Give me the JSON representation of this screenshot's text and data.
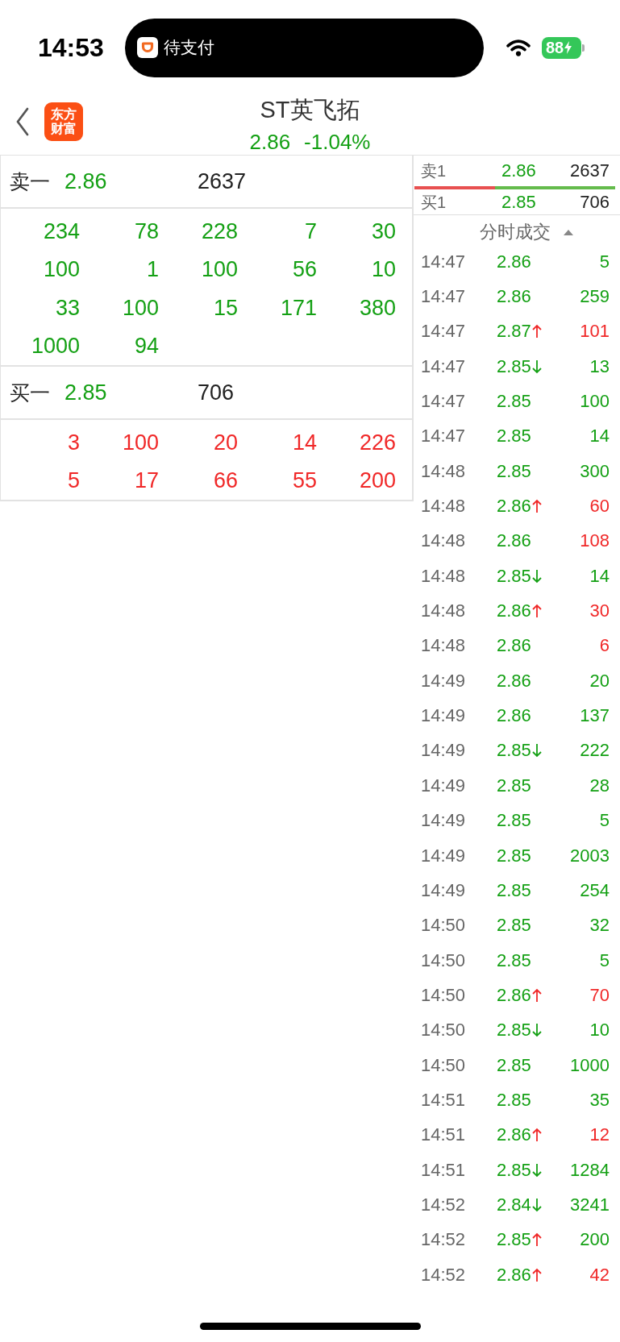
{
  "status_bar": {
    "time": "14:53",
    "activity": "待支付",
    "battery": "88"
  },
  "header": {
    "logo": "东方财富",
    "title": "ST英飞拓",
    "price": "2.86",
    "change": "-1.04%",
    "falling": true
  },
  "order_book": {
    "sides": [
      {
        "label": "卖一",
        "price": "2.86",
        "volume": "2637",
        "bid": false,
        "queue": [
          "234",
          "78",
          "228",
          "7",
          "30",
          "100",
          "1",
          "100",
          "56",
          "10",
          "33",
          "100",
          "15",
          "171",
          "380",
          "1000",
          "94"
        ]
      },
      {
        "label": "买一",
        "price": "2.85",
        "volume": "706",
        "bid": true,
        "queue": [
          "3",
          "100",
          "20",
          "14",
          "226",
          "5",
          "17",
          "66",
          "55",
          "200"
        ]
      }
    ]
  },
  "level1": {
    "rows": [
      {
        "label": "卖1",
        "price": "2.86",
        "volume": "2637"
      },
      {
        "label": "买1",
        "price": "2.85",
        "volume": "706"
      }
    ],
    "ratio": {
      "level": 0.4
    }
  },
  "trades": {
    "title": "分时成交",
    "rows": [
      {
        "time": "14:47",
        "price": "2.86",
        "up": false,
        "down": false,
        "volume": "5",
        "buy": false
      },
      {
        "time": "14:47",
        "price": "2.86",
        "up": false,
        "down": false,
        "volume": "259",
        "buy": false
      },
      {
        "time": "14:47",
        "price": "2.87",
        "up": true,
        "down": false,
        "volume": "101",
        "buy": true
      },
      {
        "time": "14:47",
        "price": "2.85",
        "up": false,
        "down": true,
        "volume": "13",
        "buy": false
      },
      {
        "time": "14:47",
        "price": "2.85",
        "up": false,
        "down": false,
        "volume": "100",
        "buy": false
      },
      {
        "time": "14:47",
        "price": "2.85",
        "up": false,
        "down": false,
        "volume": "14",
        "buy": false
      },
      {
        "time": "14:48",
        "price": "2.85",
        "up": false,
        "down": false,
        "volume": "300",
        "buy": false
      },
      {
        "time": "14:48",
        "price": "2.86",
        "up": true,
        "down": false,
        "volume": "60",
        "buy": true
      },
      {
        "time": "14:48",
        "price": "2.86",
        "up": false,
        "down": false,
        "volume": "108",
        "buy": true
      },
      {
        "time": "14:48",
        "price": "2.85",
        "up": false,
        "down": true,
        "volume": "14",
        "buy": false
      },
      {
        "time": "14:48",
        "price": "2.86",
        "up": true,
        "down": false,
        "volume": "30",
        "buy": true
      },
      {
        "time": "14:48",
        "price": "2.86",
        "up": false,
        "down": false,
        "volume": "6",
        "buy": true
      },
      {
        "time": "14:49",
        "price": "2.86",
        "up": false,
        "down": false,
        "volume": "20",
        "buy": false
      },
      {
        "time": "14:49",
        "price": "2.86",
        "up": false,
        "down": false,
        "volume": "137",
        "buy": false
      },
      {
        "time": "14:49",
        "price": "2.85",
        "up": false,
        "down": true,
        "volume": "222",
        "buy": false
      },
      {
        "time": "14:49",
        "price": "2.85",
        "up": false,
        "down": false,
        "volume": "28",
        "buy": false
      },
      {
        "time": "14:49",
        "price": "2.85",
        "up": false,
        "down": false,
        "volume": "5",
        "buy": false
      },
      {
        "time": "14:49",
        "price": "2.85",
        "up": false,
        "down": false,
        "volume": "2003",
        "buy": false
      },
      {
        "time": "14:49",
        "price": "2.85",
        "up": false,
        "down": false,
        "volume": "254",
        "buy": false
      },
      {
        "time": "14:50",
        "price": "2.85",
        "up": false,
        "down": false,
        "volume": "32",
        "buy": false
      },
      {
        "time": "14:50",
        "price": "2.85",
        "up": false,
        "down": false,
        "volume": "5",
        "buy": false
      },
      {
        "time": "14:50",
        "price": "2.86",
        "up": true,
        "down": false,
        "volume": "70",
        "buy": true
      },
      {
        "time": "14:50",
        "price": "2.85",
        "up": false,
        "down": true,
        "volume": "10",
        "buy": false
      },
      {
        "time": "14:50",
        "price": "2.85",
        "up": false,
        "down": false,
        "volume": "1000",
        "buy": false
      },
      {
        "time": "14:51",
        "price": "2.85",
        "up": false,
        "down": false,
        "volume": "35",
        "buy": false
      },
      {
        "time": "14:51",
        "price": "2.86",
        "up": true,
        "down": false,
        "volume": "12",
        "buy": true
      },
      {
        "time": "14:51",
        "price": "2.85",
        "up": false,
        "down": true,
        "volume": "1284",
        "buy": false
      },
      {
        "time": "14:52",
        "price": "2.84",
        "up": false,
        "down": true,
        "volume": "3241",
        "buy": false
      },
      {
        "time": "14:52",
        "price": "2.85",
        "up": true,
        "down": false,
        "volume": "200",
        "buy": false
      },
      {
        "time": "14:52",
        "price": "2.86",
        "up": true,
        "down": false,
        "volume": "42",
        "buy": true
      }
    ]
  }
}
